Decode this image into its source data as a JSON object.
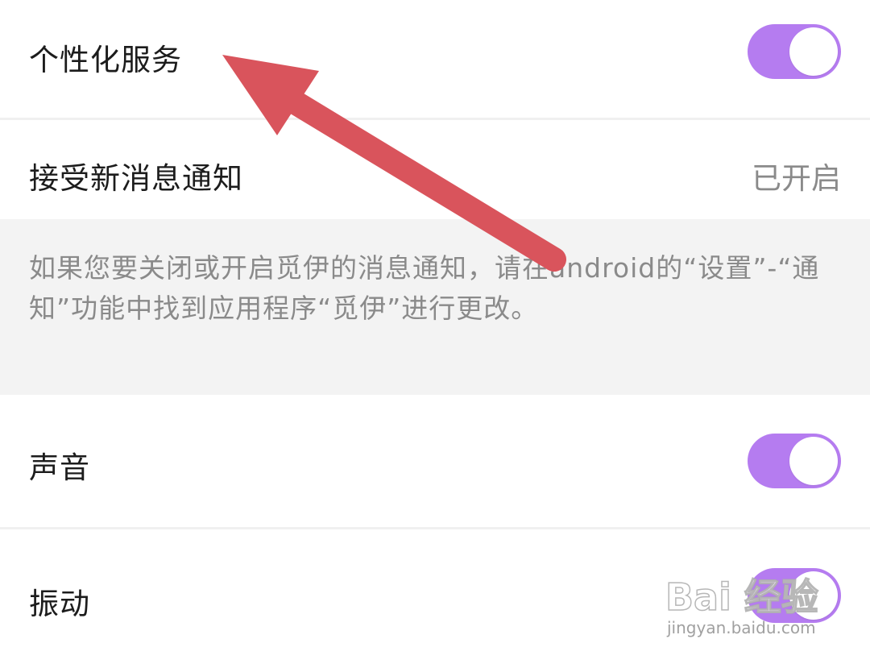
{
  "settings": {
    "personalized_service": {
      "label": "个性化服务",
      "enabled": true
    },
    "new_message_notification": {
      "label": "接受新消息通知",
      "value": "已开启"
    },
    "note": "如果您要关闭或开启觅伊的消息通知，请在android的“设置”-“通知”功能中找到应用程序“觅伊”进行更改。",
    "sound": {
      "label": "声音",
      "enabled": true
    },
    "vibration": {
      "label": "振动",
      "enabled": true
    }
  },
  "watermark": {
    "brand": "Bai 经验",
    "url": "jingyan.baidu.com"
  },
  "colors": {
    "toggle_on": "#b57cf0",
    "annotation_arrow": "#d9545c",
    "label_text": "#1c1c1c",
    "secondary_text": "#8a8a8a",
    "note_background": "#f3f3f3"
  },
  "icons": {
    "annotation": "arrow-icon"
  }
}
